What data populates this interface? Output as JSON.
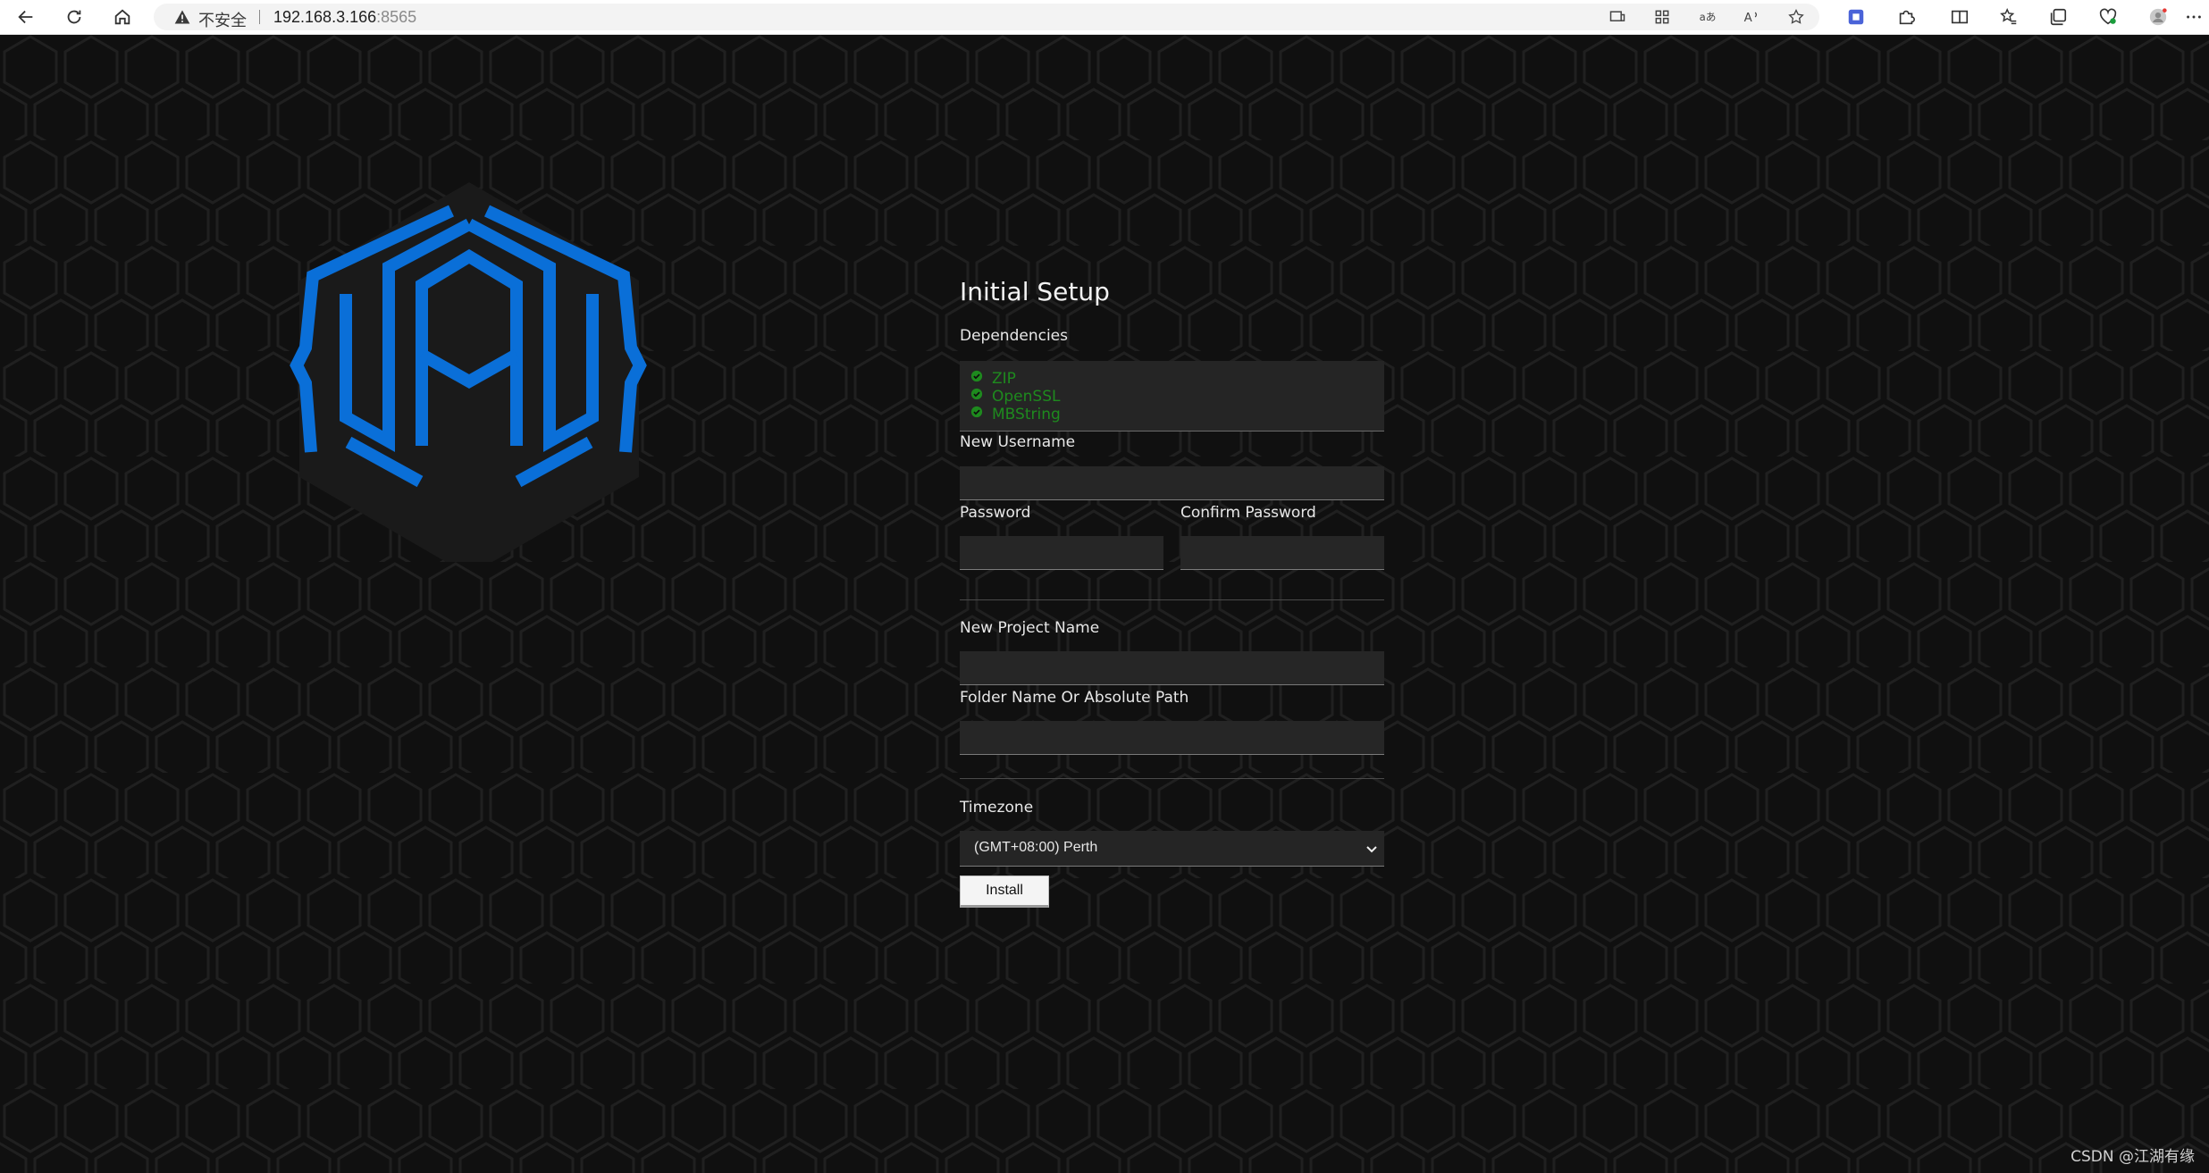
{
  "browser": {
    "security_label": "不安全",
    "url_host": "192.168.3.166",
    "url_port": ":8565",
    "icons": [
      "back-icon",
      "refresh-icon",
      "home-icon",
      "warning-icon",
      "reader-view-icon",
      "apps-icon",
      "translate-icon",
      "read-aloud-icon",
      "favorite-star-icon",
      "extension-icon",
      "puzzle-icon",
      "split-screen-icon",
      "favorites-icon",
      "collections-icon",
      "health-icon",
      "profile-icon",
      "more-icon"
    ]
  },
  "logo": {
    "name": "hexagon-logo",
    "colors": {
      "stroke": "#0a6fd8",
      "hex_bg": "#1a1a1a"
    }
  },
  "setup": {
    "title": "Initial Setup",
    "dependencies_label": "Dependencies",
    "dependencies": [
      "ZIP",
      "OpenSSL",
      "MBString"
    ],
    "username_label": "New Username",
    "password_label": "Password",
    "confirm_password_label": "Confirm Password",
    "project_name_label": "New Project Name",
    "folder_label": "Folder Name Or Absolute Path",
    "timezone_label": "Timezone",
    "timezone_value": "(GMT+08:00) Perth",
    "install_label": "Install"
  },
  "colors": {
    "page_bg": "#101010",
    "dependency_ok": "#1e8a1e",
    "logo_blue": "#0a6fd8"
  },
  "watermark": "CSDN @江湖有缘"
}
